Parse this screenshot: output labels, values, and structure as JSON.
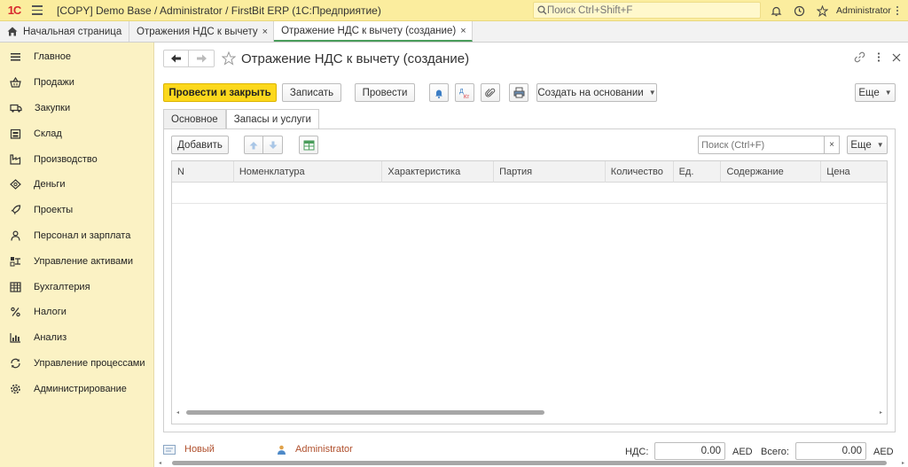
{
  "topbar": {
    "logo_text": "1С",
    "title": "[COPY] Demo Base / Administrator / FirstBit ERP  (1С:Предприятие)",
    "search_placeholder": "Поиск Ctrl+Shift+F",
    "user": "Administrator"
  },
  "tabs": {
    "home": "Начальная страница",
    "tab1": "Отражения НДС к вычету",
    "tab2": "Отражение НДС к вычету (создание)",
    "close_glyph": "×"
  },
  "sidebar": {
    "items": [
      {
        "label": "Главное",
        "icon": "menu-icon"
      },
      {
        "label": "Продажи",
        "icon": "basket-icon"
      },
      {
        "label": "Закупки",
        "icon": "truck-icon"
      },
      {
        "label": "Склад",
        "icon": "warehouse-icon"
      },
      {
        "label": "Производство",
        "icon": "factory-icon"
      },
      {
        "label": "Деньги",
        "icon": "money-icon"
      },
      {
        "label": "Проекты",
        "icon": "rocket-icon"
      },
      {
        "label": "Персонал и зарплата",
        "icon": "person-icon"
      },
      {
        "label": "Управление активами",
        "icon": "assets-icon"
      },
      {
        "label": "Бухгалтерия",
        "icon": "ledger-icon"
      },
      {
        "label": "Налоги",
        "icon": "percent-icon"
      },
      {
        "label": "Анализ",
        "icon": "chart-icon"
      },
      {
        "label": "Управление процессами",
        "icon": "process-icon"
      },
      {
        "label": "Администрирование",
        "icon": "gear-icon"
      }
    ]
  },
  "document": {
    "title": "Отражение НДС к вычету (создание)"
  },
  "toolbar": {
    "post_close": "Провести и закрыть",
    "save": "Записать",
    "post": "Провести",
    "create_based": "Создать на основании",
    "more": "Еще"
  },
  "form_tabs": {
    "main": "Основное",
    "goods": "Запасы и услуги"
  },
  "table_bar": {
    "add": "Добавить",
    "search_placeholder": "Поиск (Ctrl+F)",
    "clear": "×",
    "more": "Еще"
  },
  "table": {
    "columns": [
      "N",
      "Номенклатура",
      "Характеристика",
      "Партия",
      "Количество",
      "Ед.",
      "Содержание",
      "Цена"
    ],
    "rows": []
  },
  "footer": {
    "status": "Новый",
    "user": "Administrator",
    "vat_label": "НДС:",
    "vat_value": "0.00",
    "vat_currency": "AED",
    "total_label": "Всего:",
    "total_value": "0.00",
    "total_currency": "AED"
  },
  "colors": {
    "topbar": "#fbed9e",
    "sidebar": "#fbf2c4",
    "primary_button": "#fcd81c",
    "active_tab_underline": "#4a9d5c",
    "link": "#b0502d"
  }
}
